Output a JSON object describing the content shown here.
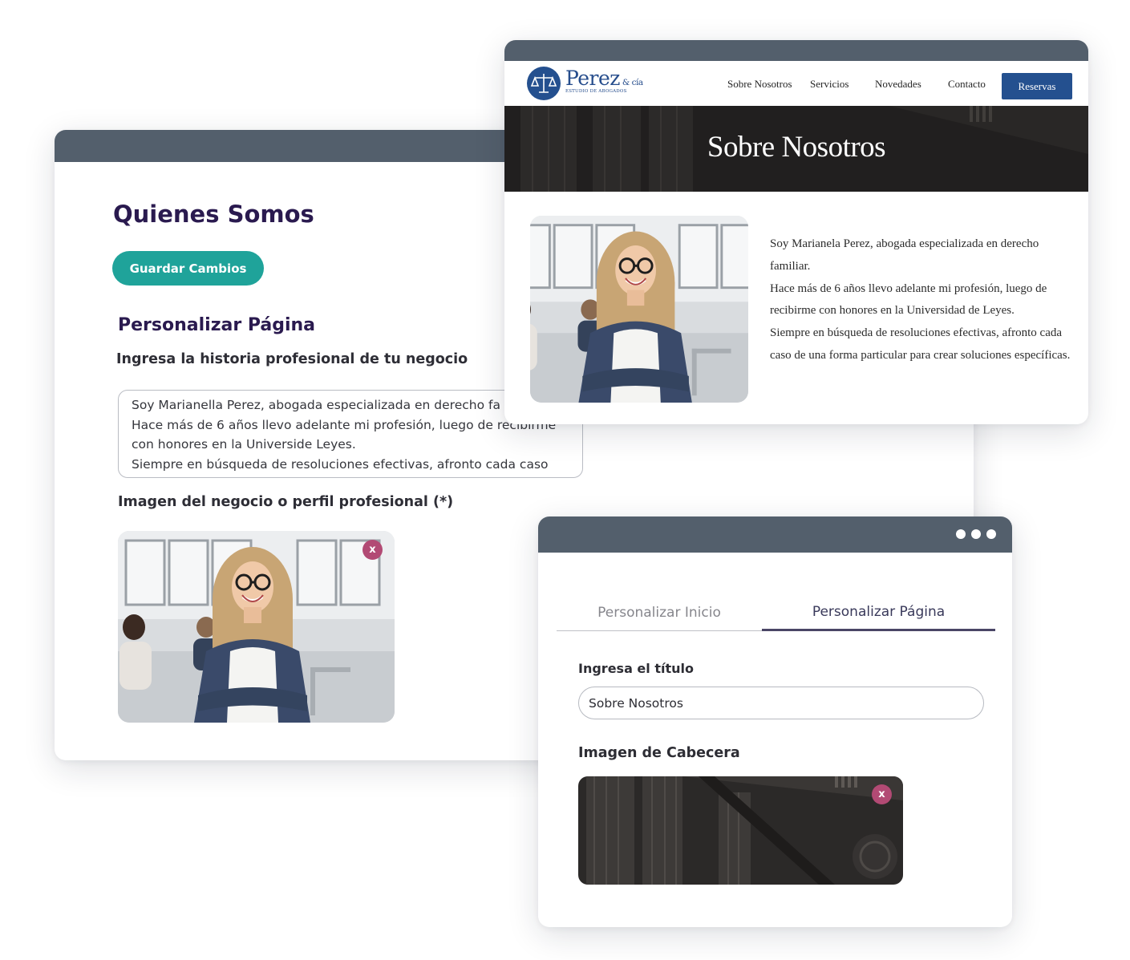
{
  "editor": {
    "title": "Quienes Somos",
    "save_label": "Guardar Cambios",
    "section_title": "Personalizar Página",
    "story_label": "Ingresa la historia profesional de tu negocio",
    "story_lines": [
      "Soy Marianella Perez, abogada especializada en derecho fa",
      "Hace más de 6 años llevo adelante mi profesión, luego de recibirme",
      "con honores en la Universide Leyes.",
      "Siempre en búsqueda de resoluciones efectivas, afronto cada caso"
    ],
    "image_label": "Imagen del negocio o perfil profesional (*)",
    "remove_label": "x"
  },
  "site": {
    "brand": "Perez",
    "brand_suffix": "& cía",
    "brand_tagline": "ESTUDIO DE ABOGADOS",
    "nav": [
      "Sobre Nosotros",
      "Servicios",
      "Novedades",
      "Contacto"
    ],
    "cta": "Reservas",
    "hero_title": "Sobre Nosotros",
    "bio": [
      "Soy Marianela Perez, abogada especializada en derecho familiar.",
      "Hace más de 6 años llevo adelante mi profesión, luego de recibirme con honores en la Universidad de Leyes.",
      "Siempre en búsqueda de resoluciones efectivas, afronto cada caso de una forma particular para crear soluciones específicas."
    ]
  },
  "panel": {
    "tabs": [
      "Personalizar Inicio",
      "Personalizar Página"
    ],
    "active_tab": "Personalizar Página",
    "title_label": "Ingresa el título",
    "title_value": "Sobre Nosotros",
    "header_image_label": "Imagen de Cabecera",
    "remove_label": "x"
  },
  "colors": {
    "window_bar": "#535f6c",
    "heading": "#2a1a4f",
    "save_button": "#1fa39a",
    "remove_button": "#b24a74",
    "brand_blue": "#24508f"
  }
}
